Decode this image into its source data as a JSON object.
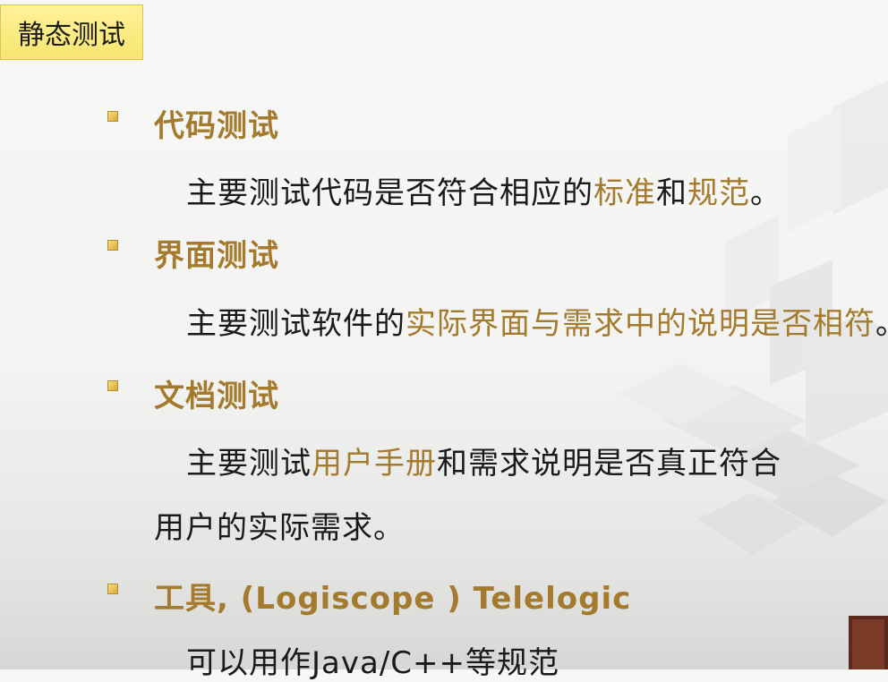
{
  "title": "静态测试",
  "sections": [
    {
      "heading": "代码测试",
      "body": {
        "p1": "主要测试代码是否符合相应的",
        "hl1": "标准",
        "p2": "和",
        "hl2": "规范",
        "p3": "。"
      }
    },
    {
      "heading": "界面测试",
      "body": {
        "p1": "主要测试软件的",
        "hl1": "实际界面与需求中的说明是否相符",
        "p2": "。"
      }
    },
    {
      "heading": "文档测试",
      "body": {
        "p1": "主要测试",
        "hl1": "用户手册",
        "p2": "和需求说明是否真正符合",
        "line2": "用户的实际需求。"
      }
    },
    {
      "heading": "工具, (Logiscope ) Telelogic",
      "body": {
        "p1": "可以用作Java/C++等规范"
      }
    }
  ],
  "colors": {
    "accent": "#a47a2d",
    "title_bg": "#f6e66f",
    "text": "#1a1a1a"
  }
}
